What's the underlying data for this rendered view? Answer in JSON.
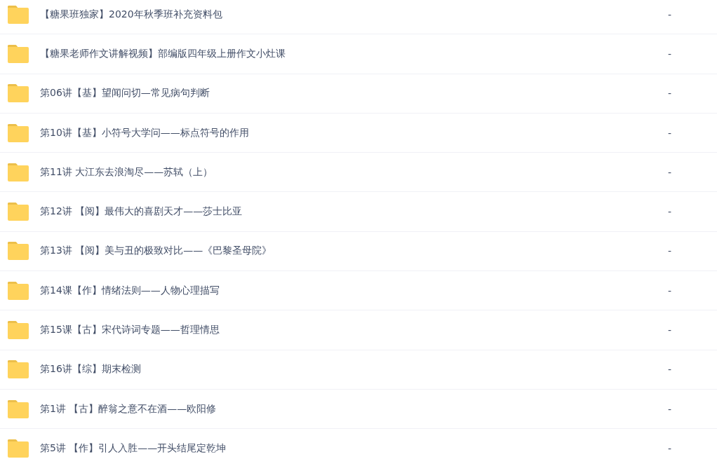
{
  "files": [
    {
      "name": "【糖果班独家】2020年秋季班补充资料包",
      "size": "-"
    },
    {
      "name": "【糖果老师作文讲解视频】部编版四年级上册作文小灶课",
      "size": "-"
    },
    {
      "name": "第06讲【基】望闻问切—常见病句判断",
      "size": "-"
    },
    {
      "name": "第10讲【基】小符号大学问——标点符号的作用",
      "size": "-"
    },
    {
      "name": "第11讲 大江东去浪淘尽——苏轼（上）",
      "size": "-"
    },
    {
      "name": "第12讲 【阅】最伟大的喜剧天才——莎士比亚",
      "size": "-"
    },
    {
      "name": "第13讲 【阅】美与丑的极致对比——《巴黎圣母院》",
      "size": "-"
    },
    {
      "name": "第14课【作】情绪法则——人物心理描写",
      "size": "-"
    },
    {
      "name": "第15课【古】宋代诗词专题——哲理情思",
      "size": "-"
    },
    {
      "name": "第16讲【综】期末检测",
      "size": "-"
    },
    {
      "name": "第1讲 【古】醉翁之意不在酒——欧阳修",
      "size": "-"
    },
    {
      "name": "第5讲 【作】引人入胜——开头结尾定乾坤",
      "size": "-"
    }
  ]
}
